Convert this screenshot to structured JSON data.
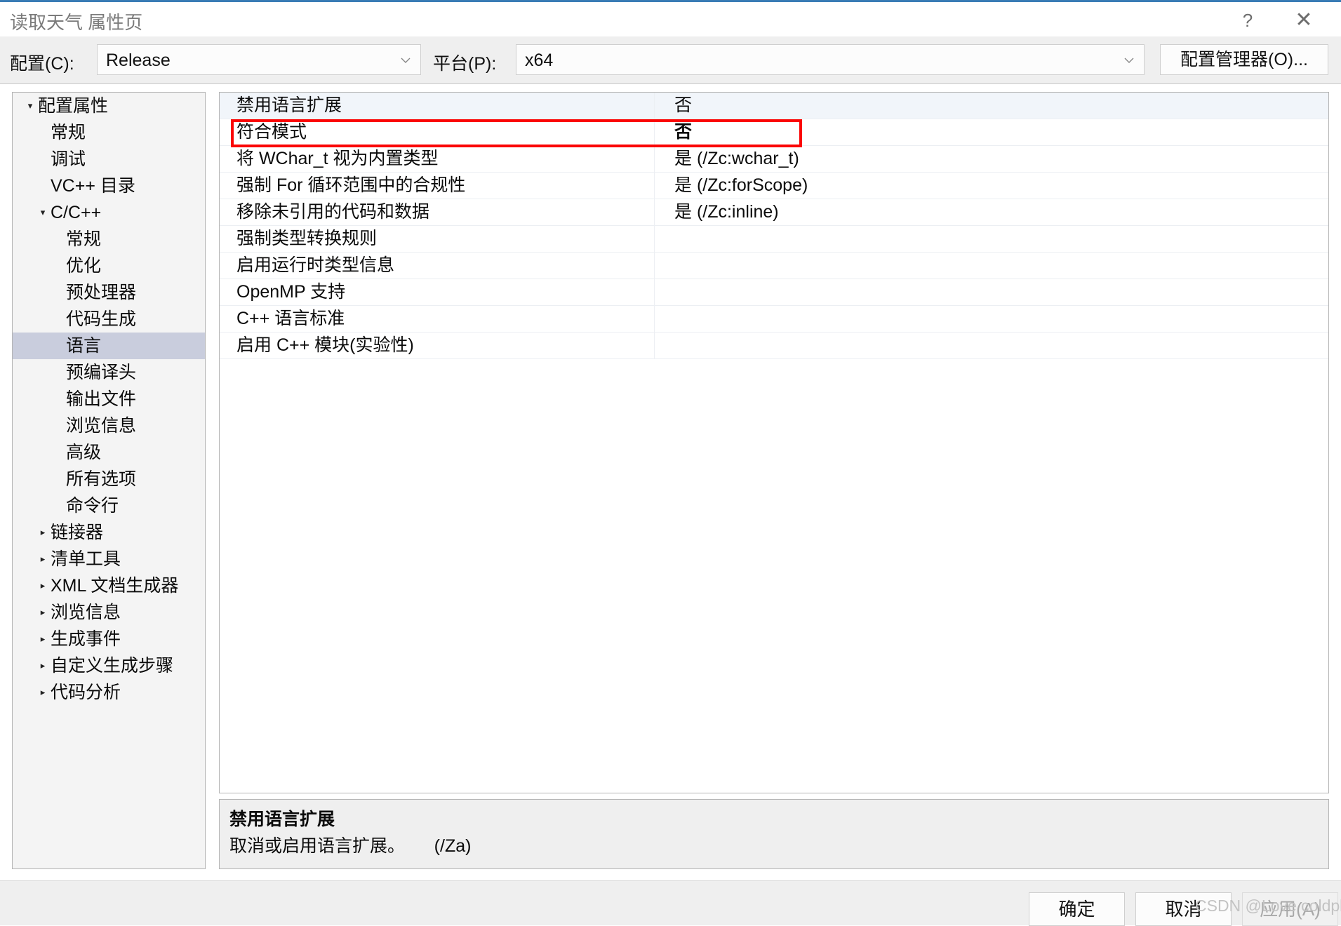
{
  "window": {
    "title": "读取天气 属性页",
    "help_icon": "?",
    "close_icon": "✕"
  },
  "configbar": {
    "config_label": "配置(C):",
    "config_value": "Release",
    "platform_label": "平台(P):",
    "platform_value": "x64",
    "config_manager_button": "配置管理器(O)..."
  },
  "sidebar": {
    "items": [
      {
        "label": "配置属性",
        "level": 0,
        "twisty": "▾",
        "selected": false
      },
      {
        "label": "常规",
        "level": 1,
        "twisty": "",
        "selected": false
      },
      {
        "label": "调试",
        "level": 1,
        "twisty": "",
        "selected": false
      },
      {
        "label": "VC++ 目录",
        "level": 1,
        "twisty": "",
        "selected": false
      },
      {
        "label": "C/C++",
        "level": 1,
        "twisty": "▾",
        "selected": false
      },
      {
        "label": "常规",
        "level": 2,
        "twisty": "",
        "selected": false
      },
      {
        "label": "优化",
        "level": 2,
        "twisty": "",
        "selected": false
      },
      {
        "label": "预处理器",
        "level": 2,
        "twisty": "",
        "selected": false
      },
      {
        "label": "代码生成",
        "level": 2,
        "twisty": "",
        "selected": false
      },
      {
        "label": "语言",
        "level": 2,
        "twisty": "",
        "selected": true
      },
      {
        "label": "预编译头",
        "level": 2,
        "twisty": "",
        "selected": false
      },
      {
        "label": "输出文件",
        "level": 2,
        "twisty": "",
        "selected": false
      },
      {
        "label": "浏览信息",
        "level": 2,
        "twisty": "",
        "selected": false
      },
      {
        "label": "高级",
        "level": 2,
        "twisty": "",
        "selected": false
      },
      {
        "label": "所有选项",
        "level": 2,
        "twisty": "",
        "selected": false
      },
      {
        "label": "命令行",
        "level": 2,
        "twisty": "",
        "selected": false
      },
      {
        "label": "链接器",
        "level": 1,
        "twisty": "▸",
        "selected": false
      },
      {
        "label": "清单工具",
        "level": 1,
        "twisty": "▸",
        "selected": false
      },
      {
        "label": "XML 文档生成器",
        "level": 1,
        "twisty": "▸",
        "selected": false
      },
      {
        "label": "浏览信息",
        "level": 1,
        "twisty": "▸",
        "selected": false
      },
      {
        "label": "生成事件",
        "level": 1,
        "twisty": "▸",
        "selected": false
      },
      {
        "label": "自定义生成步骤",
        "level": 1,
        "twisty": "▸",
        "selected": false
      },
      {
        "label": "代码分析",
        "level": 1,
        "twisty": "▸",
        "selected": false
      }
    ]
  },
  "property_grid": {
    "rows": [
      {
        "name": "禁用语言扩展",
        "value": "否",
        "bold": false,
        "selected": true,
        "highlighted": false
      },
      {
        "name": "符合模式",
        "value": "否",
        "bold": true,
        "selected": false,
        "highlighted": true
      },
      {
        "name": "将 WChar_t 视为内置类型",
        "value": "是 (/Zc:wchar_t)",
        "bold": false,
        "selected": false,
        "highlighted": false
      },
      {
        "name": "强制 For 循环范围中的合规性",
        "value": "是 (/Zc:forScope)",
        "bold": false,
        "selected": false,
        "highlighted": false
      },
      {
        "name": "移除未引用的代码和数据",
        "value": "是 (/Zc:inline)",
        "bold": false,
        "selected": false,
        "highlighted": false
      },
      {
        "name": "强制类型转换规则",
        "value": "",
        "bold": false,
        "selected": false,
        "highlighted": false
      },
      {
        "name": "启用运行时类型信息",
        "value": "",
        "bold": false,
        "selected": false,
        "highlighted": false
      },
      {
        "name": "OpenMP 支持",
        "value": "",
        "bold": false,
        "selected": false,
        "highlighted": false
      },
      {
        "name": "C++ 语言标准",
        "value": "",
        "bold": false,
        "selected": false,
        "highlighted": false
      },
      {
        "name": "启用 C++ 模块(实验性)",
        "value": "",
        "bold": false,
        "selected": false,
        "highlighted": false
      }
    ],
    "highlight_color": "#fb0505"
  },
  "description": {
    "title": "禁用语言扩展",
    "body": "取消或启用语言扩展。      (/Za)"
  },
  "footer": {
    "ok_label": "确定",
    "cancel_label": "取消",
    "apply_label": "应用(A)"
  },
  "watermark": "CSDN @Love coldplay"
}
